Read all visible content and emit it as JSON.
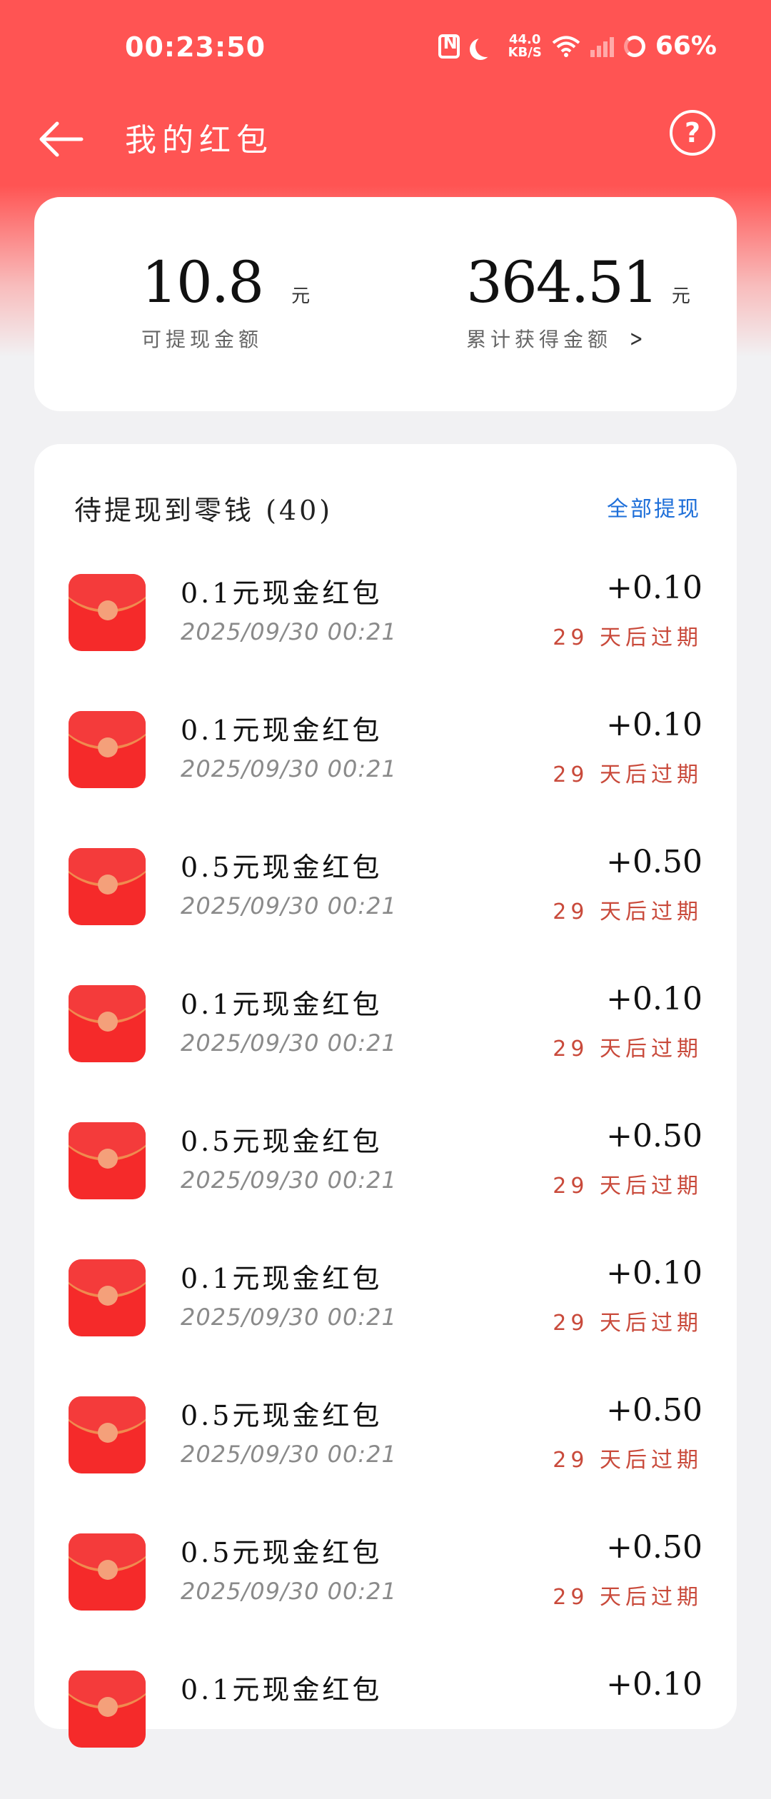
{
  "status_bar": {
    "time": "00:23:50",
    "speed_value": "44.0",
    "speed_unit": "KB/S",
    "battery": "66%"
  },
  "header": {
    "title": "我的红包",
    "help_label": "?"
  },
  "summary": {
    "withdrawable_value": "10.8",
    "withdrawable_unit": "元",
    "withdrawable_label": "可提现金额",
    "total_value": "364.51",
    "total_unit": "元",
    "total_label": "累计获得金额"
  },
  "list": {
    "title": "待提现到零钱 (40)",
    "withdraw_all": "全部提现",
    "items": [
      {
        "name": "0.1元现金红包",
        "date": "2025/09/30  00:21",
        "amount": "+0.10",
        "expire": "29 天后过期"
      },
      {
        "name": "0.1元现金红包",
        "date": "2025/09/30  00:21",
        "amount": "+0.10",
        "expire": "29 天后过期"
      },
      {
        "name": "0.5元现金红包",
        "date": "2025/09/30  00:21",
        "amount": "+0.50",
        "expire": "29 天后过期"
      },
      {
        "name": "0.1元现金红包",
        "date": "2025/09/30  00:21",
        "amount": "+0.10",
        "expire": "29 天后过期"
      },
      {
        "name": "0.5元现金红包",
        "date": "2025/09/30  00:21",
        "amount": "+0.50",
        "expire": "29 天后过期"
      },
      {
        "name": "0.1元现金红包",
        "date": "2025/09/30  00:21",
        "amount": "+0.10",
        "expire": "29 天后过期"
      },
      {
        "name": "0.5元现金红包",
        "date": "2025/09/30  00:21",
        "amount": "+0.50",
        "expire": "29 天后过期"
      },
      {
        "name": "0.5元现金红包",
        "date": "2025/09/30  00:21",
        "amount": "+0.50",
        "expire": "29 天后过期"
      },
      {
        "name": "0.1元现金红包",
        "date": "",
        "amount": "+0.10",
        "expire": ""
      }
    ]
  }
}
